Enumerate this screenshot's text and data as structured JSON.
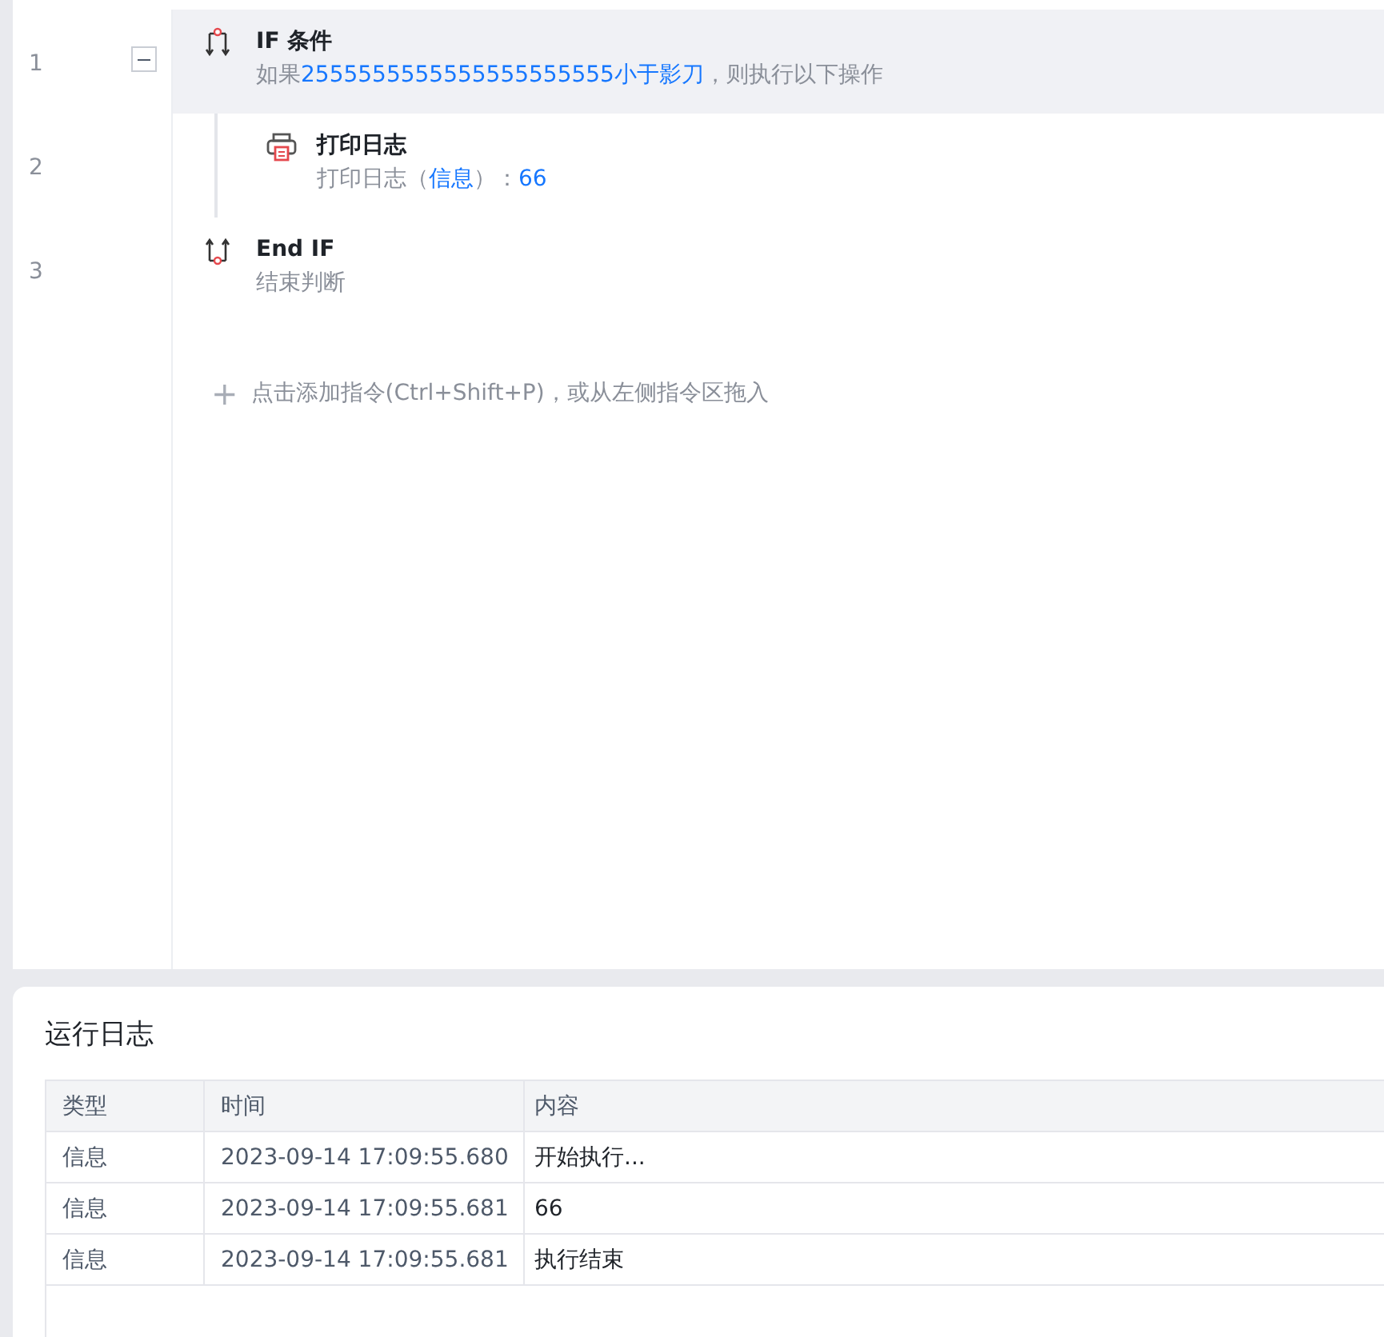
{
  "steps": [
    {
      "line": "1",
      "kind": "if",
      "title": "IF 条件",
      "selected": true,
      "expanded": true,
      "description": [
        {
          "text": "如果",
          "highlight": false
        },
        {
          "text": "2555555555555555555555小于影刀",
          "highlight": true
        },
        {
          "text": "，则执行以下操作",
          "highlight": false
        }
      ],
      "children": [
        {
          "line": "2",
          "kind": "log",
          "title": "打印日志",
          "selected": false,
          "description": [
            {
              "text": "打印日志（",
              "highlight": false
            },
            {
              "text": "信息",
              "highlight": true
            },
            {
              "text": "）：",
              "highlight": false
            },
            {
              "text": "66",
              "highlight": true
            }
          ]
        }
      ]
    },
    {
      "line": "3",
      "kind": "endif",
      "title": "End IF",
      "selected": false,
      "description": [
        {
          "text": "结束判断",
          "highlight": false
        }
      ]
    }
  ],
  "add_hint": {
    "icon": "+",
    "text": "点击添加指令(Ctrl+Shift+P)，或从左侧指令区拖入"
  },
  "log_panel": {
    "title": "运行日志",
    "columns": [
      "类型",
      "时间",
      "内容"
    ],
    "rows": [
      [
        "信息",
        "2023-09-14 17:09:55.680",
        "开始执行..."
      ],
      [
        "信息",
        "2023-09-14 17:09:55.681",
        "66"
      ],
      [
        "信息",
        "2023-09-14 17:09:55.681",
        "执行结束"
      ]
    ]
  }
}
